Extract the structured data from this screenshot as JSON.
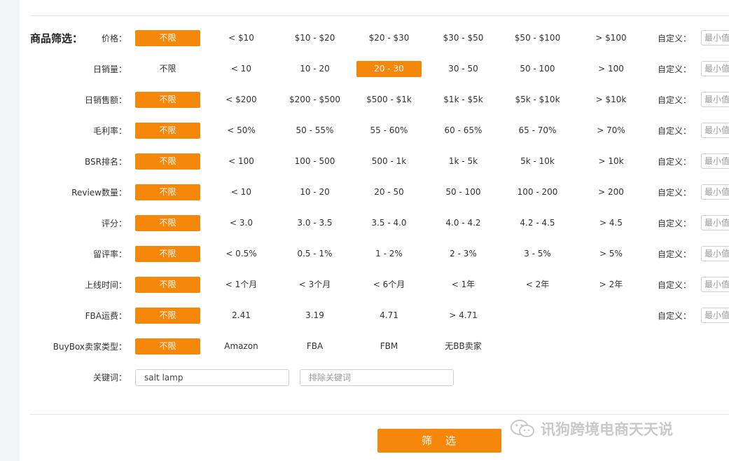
{
  "section_title": "商品筛选：",
  "custom_label": "自定义：",
  "min_placeholder": "最小值",
  "rows": [
    {
      "label": "价格：",
      "options": [
        "不限",
        "< $10",
        "$10 - $20",
        "$20 - $30",
        "$30 - $50",
        "$50 - $100",
        "> $100"
      ],
      "active": 0,
      "custom": true
    },
    {
      "label": "日销量：",
      "options": [
        "不限",
        "< 10",
        "10 - 20",
        "20 - 30",
        "30 - 50",
        "50 - 100",
        "> 100"
      ],
      "active": 3,
      "custom": true
    },
    {
      "label": "日销售额：",
      "options": [
        "不限",
        "< $200",
        "$200 - $500",
        "$500 - $1k",
        "$1k - $5k",
        "$5k - $10k",
        "> $10k"
      ],
      "active": 0,
      "custom": true
    },
    {
      "label": "毛利率：",
      "options": [
        "不限",
        "< 50%",
        "50 - 55%",
        "55 - 60%",
        "60 - 65%",
        "65 - 70%",
        "> 70%"
      ],
      "active": 0,
      "custom": true
    },
    {
      "label": "BSR排名：",
      "options": [
        "不限",
        "< 100",
        "100 - 500",
        "500 - 1k",
        "1k - 5k",
        "5k - 10k",
        "> 10k"
      ],
      "active": 0,
      "custom": true
    },
    {
      "label": "Review数量：",
      "options": [
        "不限",
        "< 10",
        "10 - 20",
        "20 - 50",
        "50 - 100",
        "100 - 200",
        "> 200"
      ],
      "active": 0,
      "custom": true
    },
    {
      "label": "评分：",
      "options": [
        "不限",
        "< 3.0",
        "3.0 - 3.5",
        "3.5 - 4.0",
        "4.0 - 4.2",
        "4.2 - 4.5",
        "> 4.5"
      ],
      "active": 0,
      "custom": true
    },
    {
      "label": "留评率：",
      "options": [
        "不限",
        "< 0.5%",
        "0.5 - 1%",
        "1 - 2%",
        "2 - 3%",
        "3 - 5%",
        "> 5%"
      ],
      "active": 0,
      "custom": true
    },
    {
      "label": "上线时间：",
      "options": [
        "不限",
        "< 1个月",
        "< 3个月",
        "< 6个月",
        "< 1年",
        "< 2年",
        "> 2年"
      ],
      "active": 0,
      "custom": true
    },
    {
      "label": "FBA运费：",
      "options": [
        "不限",
        "2.41",
        "3.19",
        "4.71",
        "> 4.71"
      ],
      "active": 0,
      "custom": true
    },
    {
      "label": "BuyBox卖家类型：",
      "options": [
        "不限",
        "Amazon",
        "FBA",
        "FBM",
        "无BB卖家"
      ],
      "active": 0,
      "custom": false
    }
  ],
  "keyword": {
    "label": "关键词：",
    "include_value": "salt lamp",
    "exclude_placeholder": "排除关键词"
  },
  "submit_label": "筛　选",
  "watermark_text": "讯狗跨境电商天天说",
  "colors": {
    "accent": "#f5870a",
    "text": "#333333",
    "border": "#cfcfcf"
  }
}
